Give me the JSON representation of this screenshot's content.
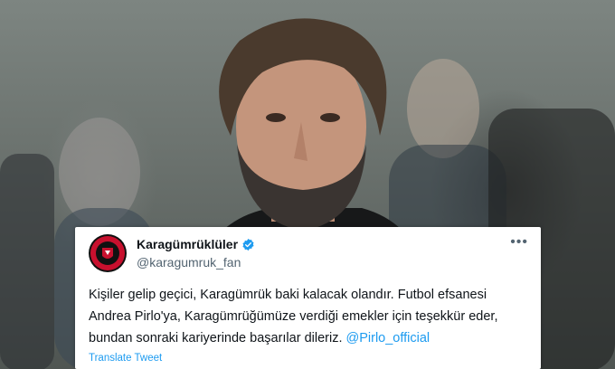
{
  "photo": {
    "subject": "man-portrait-icon"
  },
  "tweet": {
    "display_name": "Karagümrüklüler",
    "handle": "@karagumruk_fan",
    "more_label": "•••",
    "text_line1": "Kişiler gelip geçici, Karagümrük baki kalacak olandır. Futbol efsanesi",
    "text_line2": "Andrea Pirlo'ya, Karagümrüğümüze verdiği emekler için teşekkür eder,",
    "text_line3": "bundan sonraki kariyerinde başarılar dileriz.",
    "mention": "@Pirlo_official",
    "translate_label": "Translate Tweet",
    "avatar_text": "1921"
  },
  "colors": {
    "link": "#1d9bf0",
    "verified": "#1d9bf0",
    "text": "#0f1419",
    "secondary": "#536471"
  }
}
